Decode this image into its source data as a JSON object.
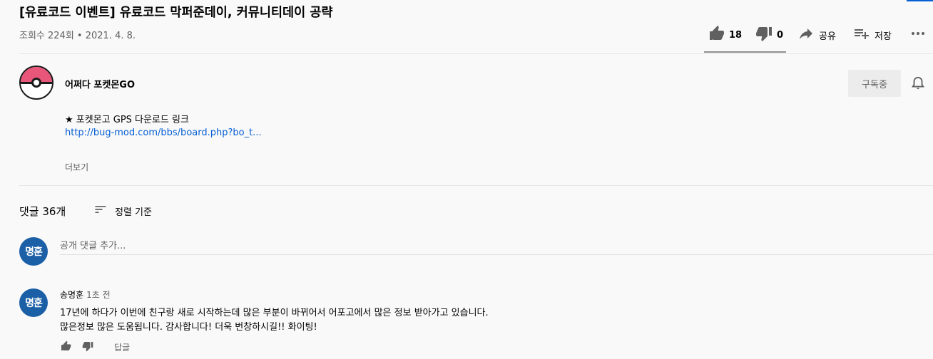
{
  "video": {
    "title": "[유료코드 이벤트] 유료코드 막퍼준데이, 커뮤니티데이 공략",
    "meta": "조회수 224회 • 2021. 4. 8.",
    "likes": "18",
    "dislikes": "0",
    "share_label": "공유",
    "save_label": "저장",
    "like_ratio": 1.0
  },
  "channel": {
    "name": "어쩌다 포켓몬GO",
    "subscribe_label": "구독중"
  },
  "description": {
    "line1": "★ 포켓몬고 GPS  다운로드 링크",
    "link": "http://bug-mod.com/bbs/board.php?bo_t...",
    "more_label": "더보기"
  },
  "comments": {
    "count_label": "댓글 36개",
    "sort_label": "정렬 기준",
    "add_placeholder": "공개 댓글 추가...",
    "current_user_avatar": "명훈",
    "items": [
      {
        "avatar": "명훈",
        "author": "송명훈",
        "time": "1초 전",
        "line1": "17년에 하다가 이번에 친구랑 새로 시작하는데 많은 부분이 바뀌어서 어포고에서 많은 정보 받아가고 있습니다.",
        "line2": "많은정보 많은 도움됩니다. 감사합니다! 더욱 번창하시길!! 화이팅!",
        "reply_label": "답글"
      }
    ]
  },
  "colors": {
    "accent": "#065fd4",
    "avatar_bg": "#1b5fa6",
    "pokeball_top": "#e8567a"
  }
}
